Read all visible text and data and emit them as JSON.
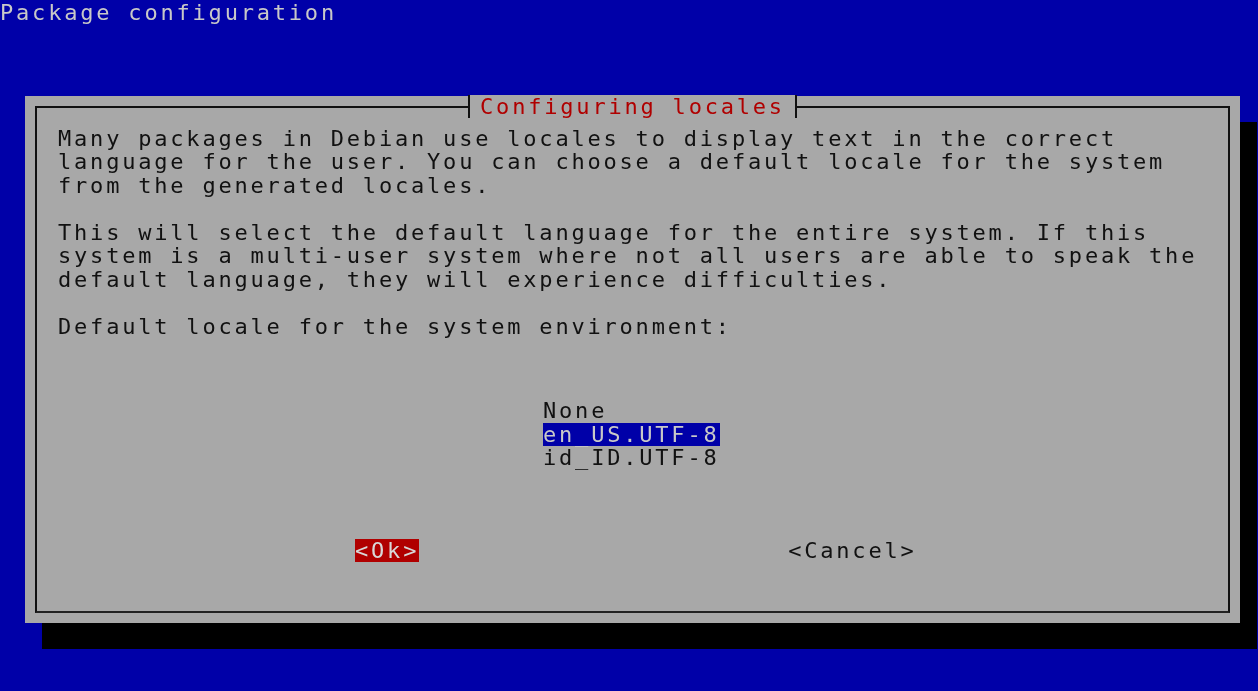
{
  "screen_title": "Package configuration",
  "dialog": {
    "title": "Configuring locales",
    "paragraphs": [
      "Many packages in Debian use locales to display text in the correct\nlanguage for the user. You can choose a default locale for the system\nfrom the generated locales.",
      "This will select the default language for the entire system. If this\nsystem is a multi-user system where not all users are able to speak the\ndefault language, they will experience difficulties."
    ],
    "prompt": "Default locale for the system environment:",
    "options": [
      {
        "label": "None",
        "selected": false
      },
      {
        "label": "en_US.UTF-8",
        "selected": true
      },
      {
        "label": "id_ID.UTF-8",
        "selected": false
      }
    ],
    "buttons": [
      {
        "label": "<Ok>",
        "focused": true
      },
      {
        "label": "<Cancel>",
        "focused": false
      }
    ]
  }
}
